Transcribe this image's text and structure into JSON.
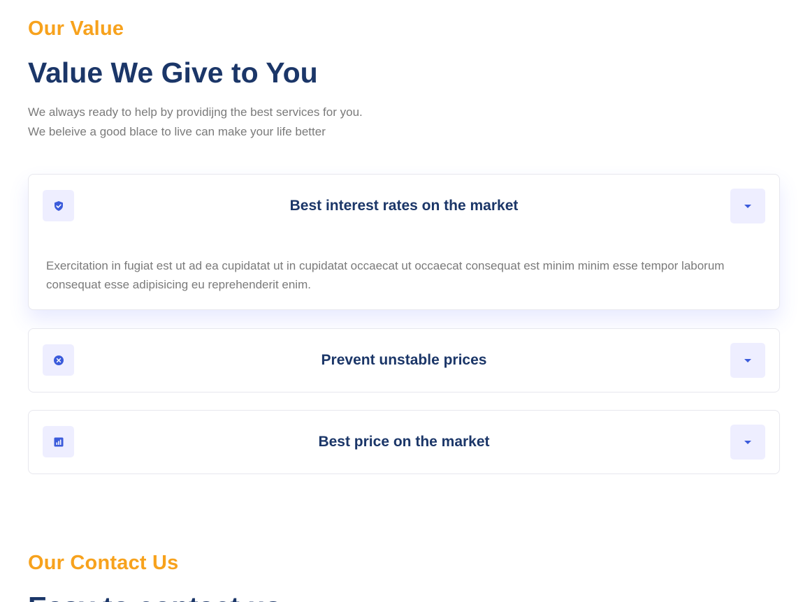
{
  "value_section": {
    "eyebrow": "Our Value",
    "title": "Value We Give to You",
    "description_lines": [
      "We always ready to help by providijng the best services for you.",
      "We beleive a good blace to live can make your life better"
    ]
  },
  "accordion": {
    "items": [
      {
        "icon": "shield-check-icon",
        "title": "Best interest rates on the market",
        "expanded": true,
        "body": "Exercitation in fugiat est ut ad ea cupidatat ut in cupidatat occaecat ut occaecat consequat est minim minim esse tempor laborum consequat esse adipisicing eu reprehenderit enim."
      },
      {
        "icon": "close-circle-icon",
        "title": "Prevent unstable prices",
        "expanded": false
      },
      {
        "icon": "bar-chart-icon",
        "title": "Best price on the market",
        "expanded": false
      }
    ]
  },
  "contact_section": {
    "eyebrow": "Our Contact Us",
    "title": "Easy to contact us"
  },
  "colors": {
    "accent_orange": "#f7a21d",
    "heading_navy": "#1b3668",
    "body_gray": "#7a7a7a",
    "icon_blue": "#3b5bdb",
    "icon_bg": "#eeeeff"
  }
}
